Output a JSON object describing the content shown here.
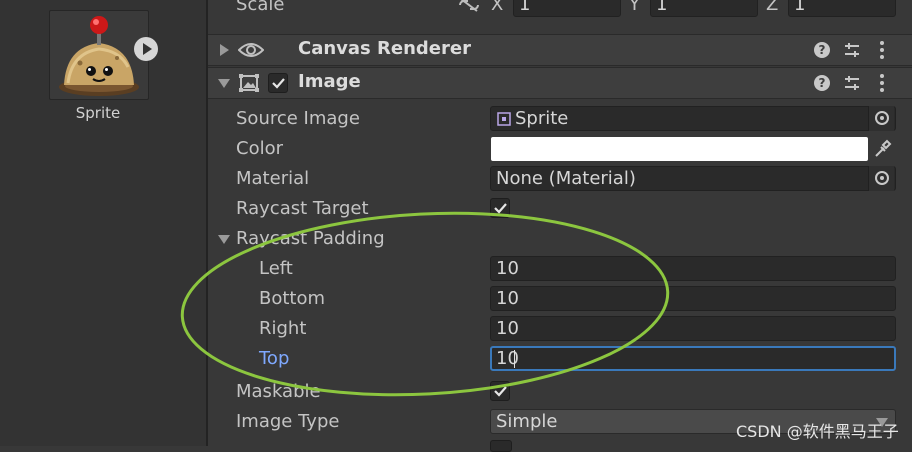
{
  "project": {
    "asset_name": "Sprite"
  },
  "transform": {
    "scale_label": "Scale",
    "x_label": "X",
    "x_value": "1",
    "y_label": "Y",
    "y_value": "1",
    "z_label": "Z",
    "z_value": "1"
  },
  "canvas_renderer": {
    "title": "Canvas Renderer"
  },
  "image": {
    "title": "Image",
    "source_image_label": "Source Image",
    "source_image_value": "Sprite",
    "color_label": "Color",
    "color_value": "#ffffff",
    "material_label": "Material",
    "material_value": "None (Material)",
    "raycast_target_label": "Raycast Target",
    "raycast_padding_label": "Raycast Padding",
    "padding": {
      "left_label": "Left",
      "left_value": "10",
      "bottom_label": "Bottom",
      "bottom_value": "10",
      "right_label": "Right",
      "right_value": "10",
      "top_label": "Top",
      "top_value": "10"
    },
    "maskable_label": "Maskable",
    "image_type_label": "Image Type",
    "image_type_value": "Simple"
  },
  "colors": {
    "annotation_ellipse": "#8cc63f",
    "focus_border": "#3a79bb",
    "active_label": "#7fa9ff"
  },
  "watermark": "CSDN @软件黑马王子"
}
